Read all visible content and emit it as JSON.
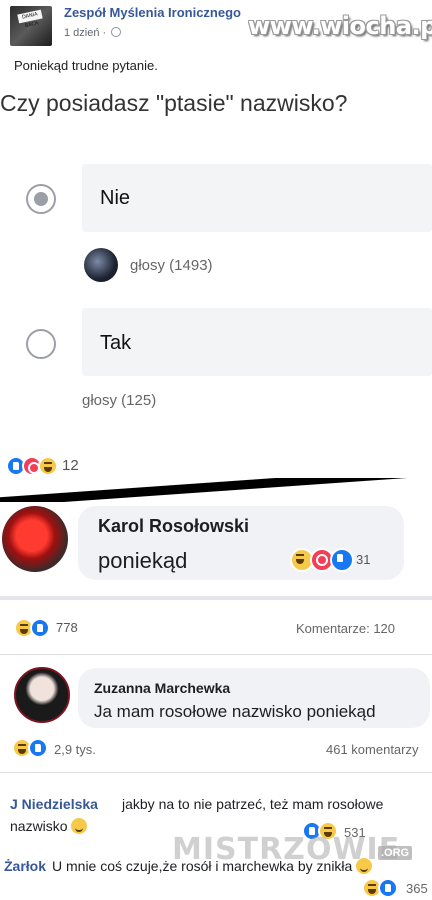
{
  "post": {
    "page_name": "Zespół Myślenia Ironicznego",
    "time": "1 dzień ·",
    "text": "Poniekąd trudne pytanie.",
    "avatar_tag": "DANIA BACA"
  },
  "watermark": "www.wiocha.pl",
  "poll": {
    "question": "Czy posiadasz \"ptasie\" nazwisko?",
    "options": [
      {
        "label": "Nie",
        "votes_text": "głosy (1493)",
        "selected": true
      },
      {
        "label": "Tak",
        "votes_text": "głosy (125)",
        "selected": false
      }
    ],
    "reactions_count": "12"
  },
  "comment_karol": {
    "name": "Karol Rosołowski",
    "text": "poniekąd",
    "reactions_count": "31"
  },
  "stats": {
    "reactions_count": "778",
    "comments_label": "Komentarze: 120"
  },
  "comment_zuzanna": {
    "name": "Zuzanna Marchewka",
    "text": "Ja mam rosołowe nazwisko poniekąd",
    "reactions_count": "2,9 tys.",
    "comments_label": "461 komentarzy"
  },
  "comment_jn": {
    "name": "J Niedzielska",
    "text_line1": "jakby na to nie patrzeć, też mam rosołowe",
    "text_line2": "nazwisko",
    "reactions_count": "531"
  },
  "comment_zarlok": {
    "name": "Żarłok",
    "text": "U mnie coś czuje,że rosół i marchewka by znikła",
    "reactions_count": "365"
  },
  "watermark2": {
    "text": "MISTRZOWIE",
    "suffix": ".ORG"
  }
}
